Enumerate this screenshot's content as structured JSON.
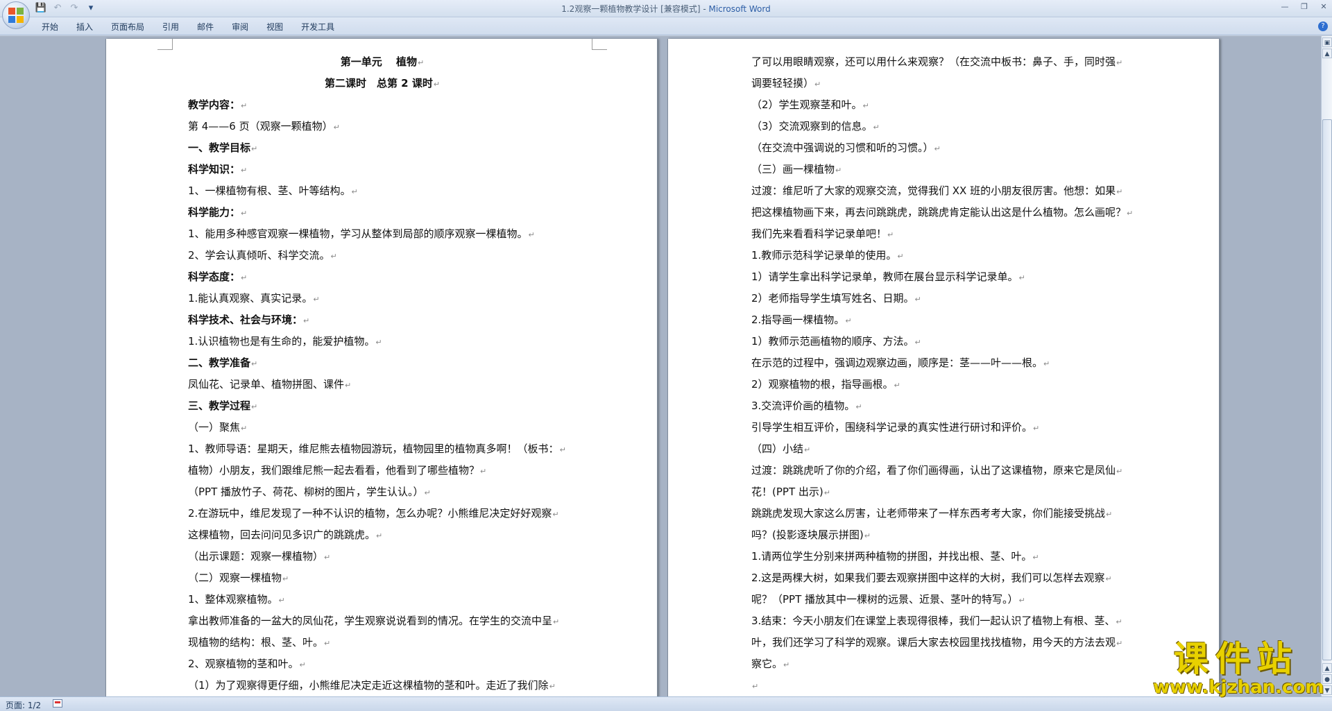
{
  "window": {
    "title": "1.2观察一颗植物教学设计 [兼容模式]",
    "app_name": "Microsoft Word",
    "separator": " - "
  },
  "quick_access": {
    "save_icon": "save-icon",
    "undo_icon": "undo-icon",
    "redo_icon": "redo-icon",
    "customize_icon": "customize-icon"
  },
  "ribbon": {
    "tabs": [
      "开始",
      "插入",
      "页面布局",
      "引用",
      "邮件",
      "审阅",
      "视图",
      "开发工具"
    ]
  },
  "status_bar": {
    "page_label": "页面: 1/2"
  },
  "watermark": {
    "text": "课件站",
    "url": "www.kjzhan.com"
  },
  "pages": {
    "left": [
      {
        "text": "第一单元　 植物",
        "style": "bold center"
      },
      {
        "text": "第二课时　总第 2 课时",
        "style": "bold center"
      },
      {
        "text": "教学内容：",
        "style": "bold"
      },
      {
        "text": "第 4——6 页（观察一颗植物）",
        "style": ""
      },
      {
        "text": "一、教学目标",
        "style": "bold"
      },
      {
        "text": "科学知识：",
        "style": "bold"
      },
      {
        "text": "1、一棵植物有根、茎、叶等结构。",
        "style": ""
      },
      {
        "text": "科学能力：",
        "style": "bold"
      },
      {
        "text": "1、能用多种感官观察一棵植物，学习从整体到局部的顺序观察一棵植物。",
        "style": ""
      },
      {
        "text": "2、学会认真倾听、科学交流。",
        "style": ""
      },
      {
        "text": "科学态度：",
        "style": "bold"
      },
      {
        "text": "1.能认真观察、真实记录。",
        "style": ""
      },
      {
        "text": "科学技术、社会与环境：",
        "style": "bold"
      },
      {
        "text": "1.认识植物也是有生命的，能爱护植物。",
        "style": ""
      },
      {
        "text": "二、教学准备",
        "style": "bold"
      },
      {
        "text": "凤仙花、记录单、植物拼图、课件",
        "style": ""
      },
      {
        "text": "三、教学过程",
        "style": "bold"
      },
      {
        "text": "（一）聚焦",
        "style": ""
      },
      {
        "text": "1、教师导语：星期天，维尼熊去植物园游玩，植物园里的植物真多啊！（板书：",
        "style": ""
      },
      {
        "text": "植物）小朋友，我们跟维尼熊一起去看看，他看到了哪些植物？",
        "style": ""
      },
      {
        "text": "（PPT 播放竹子、荷花、柳树的图片，学生认认。）",
        "style": ""
      },
      {
        "text": "2.在游玩中，维尼发现了一种不认识的植物，怎么办呢？小熊维尼决定好好观察",
        "style": ""
      },
      {
        "text": "这棵植物，回去问问见多识广的跳跳虎。",
        "style": ""
      },
      {
        "text": "（出示课题：观察一棵植物）",
        "style": ""
      },
      {
        "text": "（二）观察一棵植物",
        "style": ""
      },
      {
        "text": "1、整体观察植物。",
        "style": ""
      },
      {
        "text": "拿出教师准备的一盆大的凤仙花，学生观察说说看到的情况。在学生的交流中呈",
        "style": ""
      },
      {
        "text": "现植物的结构：根、茎、叶。",
        "style": ""
      },
      {
        "text": "2、观察植物的茎和叶。",
        "style": ""
      },
      {
        "text": "（1）为了观察得更仔细，小熊维尼决定走近这棵植物的茎和叶。走近了我们除",
        "style": ""
      }
    ],
    "right": [
      {
        "text": "了可以用眼睛观察，还可以用什么来观察？（在交流中板书：鼻子、手，同时强",
        "style": ""
      },
      {
        "text": "调要轻轻摸）",
        "style": ""
      },
      {
        "text": "（2）学生观察茎和叶。",
        "style": ""
      },
      {
        "text": "（3）交流观察到的信息。",
        "style": ""
      },
      {
        "text": "（在交流中强调说的习惯和听的习惯。）",
        "style": ""
      },
      {
        "text": "（三）画一棵植物",
        "style": ""
      },
      {
        "text": "过渡：维尼听了大家的观察交流，觉得我们 XX 班的小朋友很厉害。他想：如果",
        "style": ""
      },
      {
        "text": "把这棵植物画下来，再去问跳跳虎，跳跳虎肯定能认出这是什么植物。怎么画呢？",
        "style": ""
      },
      {
        "text": "我们先来看看科学记录单吧！",
        "style": ""
      },
      {
        "text": "1.教师示范科学记录单的使用。",
        "style": ""
      },
      {
        "text": "1）请学生拿出科学记录单，教师在展台显示科学记录单。",
        "style": ""
      },
      {
        "text": "2）老师指导学生填写姓名、日期。",
        "style": ""
      },
      {
        "text": "2.指导画一棵植物。",
        "style": ""
      },
      {
        "text": "1）教师示范画植物的顺序、方法。",
        "style": ""
      },
      {
        "text": "在示范的过程中，强调边观察边画，顺序是：茎——叶——根。",
        "style": ""
      },
      {
        "text": "2）观察植物的根，指导画根。",
        "style": ""
      },
      {
        "text": "3.交流评价画的植物。",
        "style": ""
      },
      {
        "text": "引导学生相互评价，围绕科学记录的真实性进行研讨和评价。",
        "style": ""
      },
      {
        "text": "（四）小结",
        "style": ""
      },
      {
        "text": "过渡：跳跳虎听了你的介绍，看了你们画得画，认出了这课植物，原来它是凤仙",
        "style": ""
      },
      {
        "text": "花！(PPT 出示)",
        "style": ""
      },
      {
        "text": "跳跳虎发现大家这么厉害，让老师带来了一样东西考考大家，你们能接受挑战",
        "style": ""
      },
      {
        "text": "吗？(投影逐块展示拼图)",
        "style": ""
      },
      {
        "text": "1.请两位学生分别来拼两种植物的拼图，并找出根、茎、叶。",
        "style": ""
      },
      {
        "text": "2.这是两棵大树，如果我们要去观察拼图中这样的大树，我们可以怎样去观察",
        "style": ""
      },
      {
        "text": "呢？（PPT 播放其中一棵树的远景、近景、茎叶的特写。）",
        "style": ""
      },
      {
        "text": "3.结束：今天小朋友们在课堂上表现得很棒，我们一起认识了植物上有根、茎、",
        "style": ""
      },
      {
        "text": "叶，我们还学习了科学的观察。课后大家去校园里找找植物，用今天的方法去观",
        "style": ""
      },
      {
        "text": "察它。",
        "style": ""
      },
      {
        "text": "",
        "style": ""
      }
    ]
  }
}
